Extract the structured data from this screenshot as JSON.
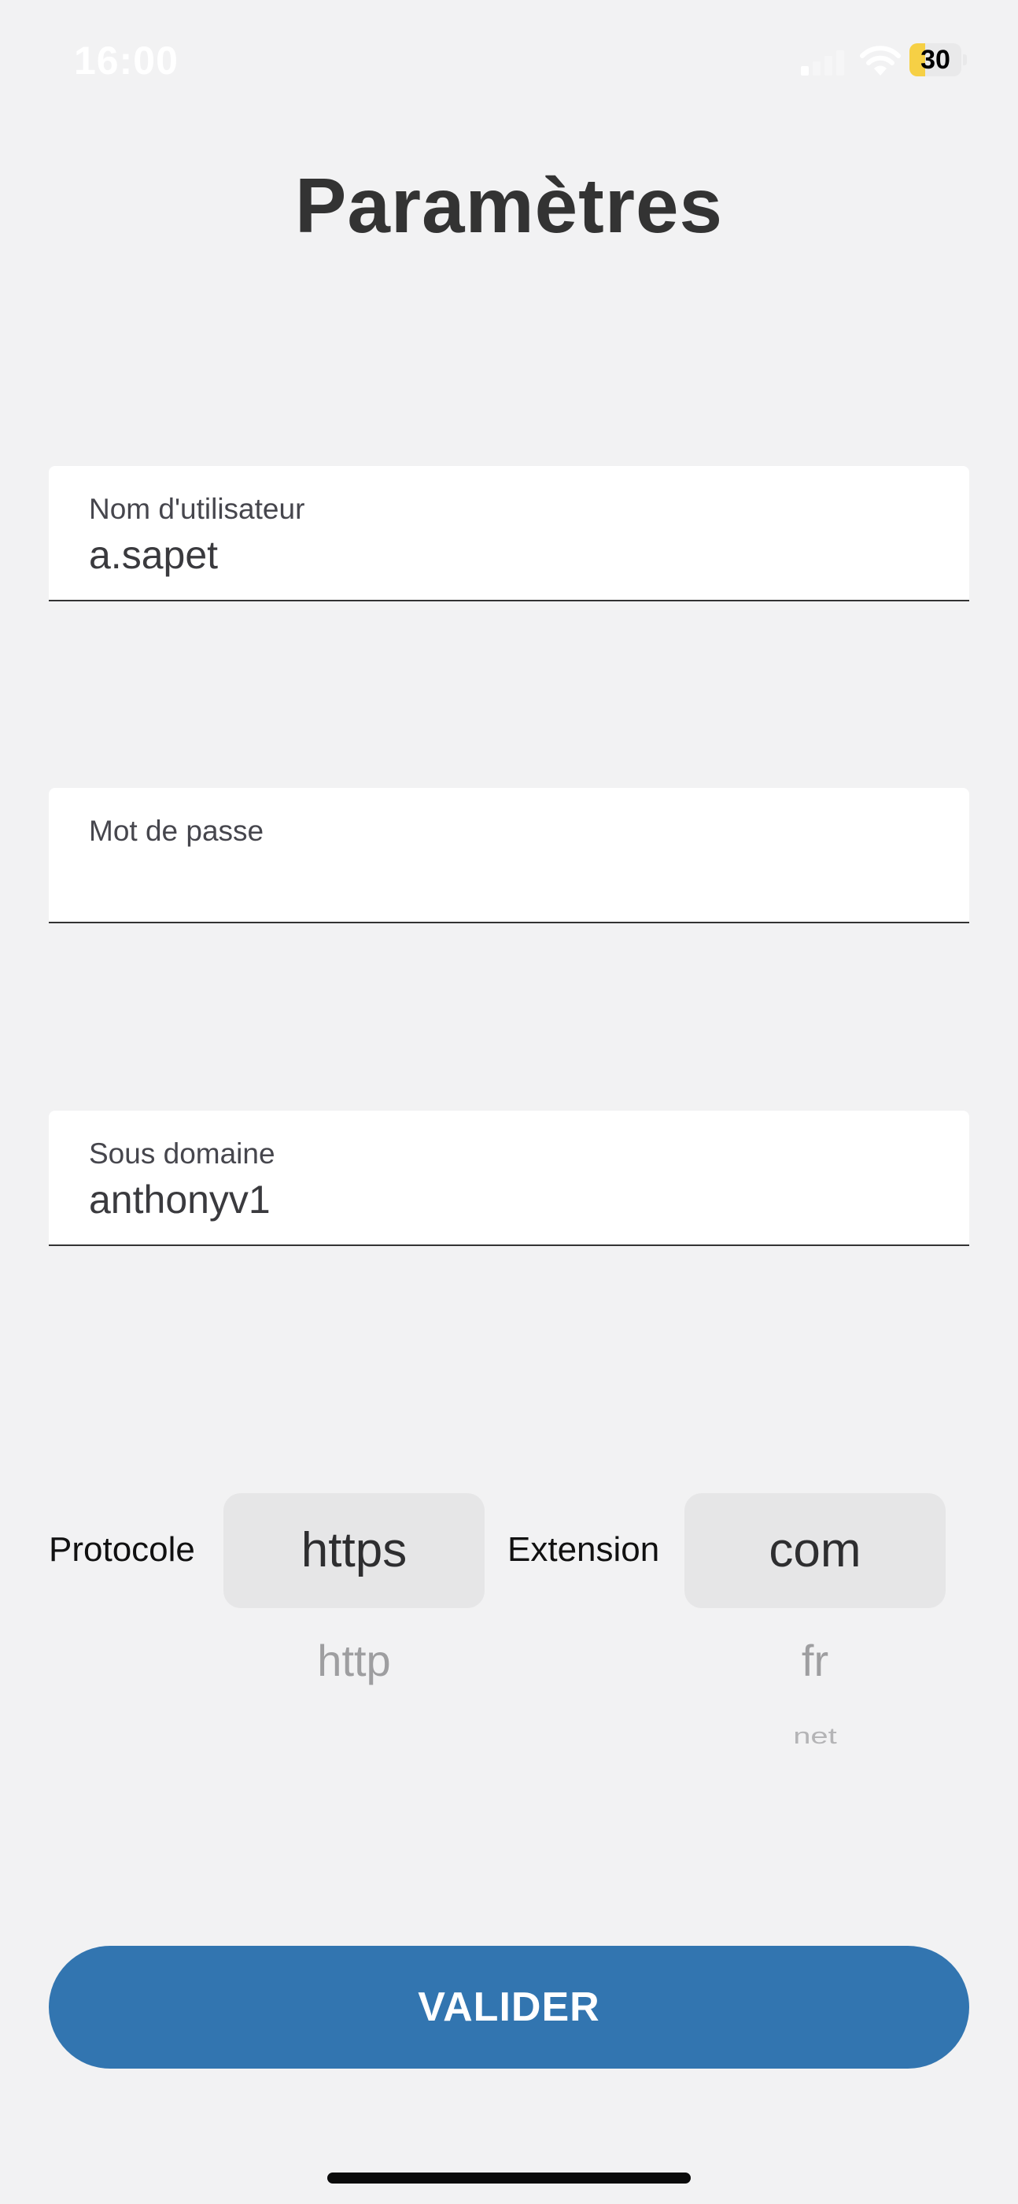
{
  "status_bar": {
    "time": "16:00",
    "battery_level": "30",
    "battery_fraction": 0.3,
    "icons": [
      "signal-icon",
      "wifi-icon",
      "battery-icon"
    ]
  },
  "page": {
    "title": "Paramètres"
  },
  "form": {
    "username": {
      "label": "Nom d'utilisateur",
      "value": "a.sapet"
    },
    "password": {
      "label": "Mot de passe",
      "value": ""
    },
    "subdomain": {
      "label": "Sous domaine",
      "value": "anthonyv1"
    }
  },
  "pickers": {
    "protocol": {
      "label": "Protocole",
      "selected": "https",
      "options_below": [
        "http"
      ]
    },
    "extension": {
      "label": "Extension",
      "selected": "com",
      "options_below": [
        "fr",
        "net"
      ]
    }
  },
  "actions": {
    "validate_label": "VALIDER"
  },
  "colors": {
    "background": "#f2f2f3",
    "accent": "#3275b0",
    "battery": "#f6d045",
    "title": "#333333"
  }
}
